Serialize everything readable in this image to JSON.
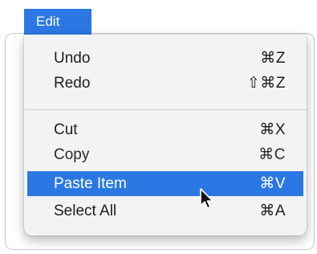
{
  "menu": {
    "title": "Edit",
    "items": [
      {
        "label": "Undo",
        "shortcut": "⌘Z"
      },
      {
        "label": "Redo",
        "shortcut": "⇧⌘Z"
      },
      {
        "label": "Cut",
        "shortcut": "⌘X"
      },
      {
        "label": "Copy",
        "shortcut": "⌘C"
      },
      {
        "label": "Paste Item",
        "shortcut": "⌘V",
        "highlighted": true
      },
      {
        "label": "Select All",
        "shortcut": "⌘A"
      }
    ]
  },
  "colors": {
    "accent": "#2b78e4",
    "menu_background": "#f3f3f3",
    "text": "#1d1d1d"
  },
  "icons": {
    "cursor": "arrow-cursor-icon"
  }
}
